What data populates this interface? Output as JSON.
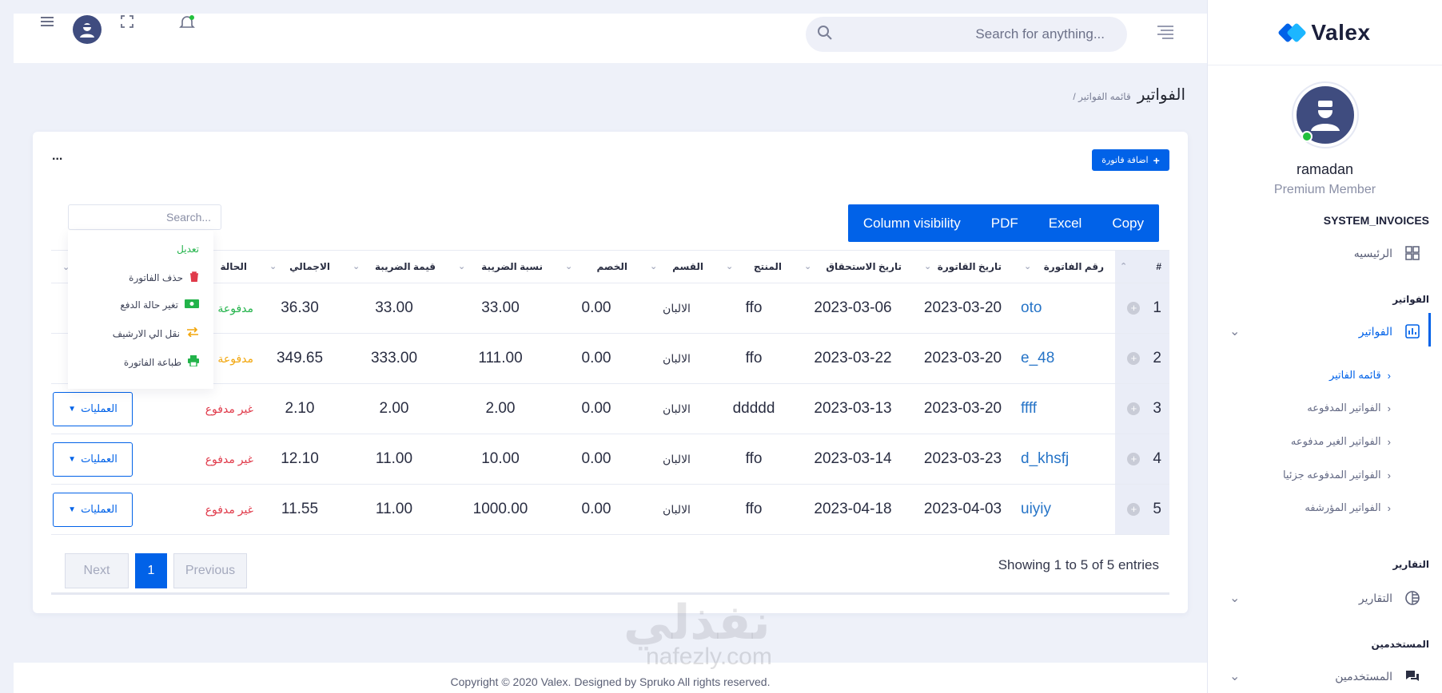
{
  "header": {
    "search_placeholder": "Search for anything..."
  },
  "sidebar": {
    "logo": "Valex",
    "user_name": "ramadan",
    "user_role": "Premium Member",
    "section_main": "SYSTEM_INVOICES",
    "home": "الرئيسيه",
    "section_invoices": "الفواتير",
    "invoices": "الفواتير",
    "sub": [
      "قائمه الفاتير",
      "الفواتير المدفوعه",
      "الفواتير الغير مدفوعه",
      "الفواتير المدفوعه جزئيا",
      "الفواتير المؤرشفه"
    ],
    "section_reports": "التقارير",
    "reports": "التقارير",
    "section_users": "المستخدمين",
    "users": "المستخدمين"
  },
  "breadcrumb": {
    "title": "الفواتير",
    "sub": "/ قائمه الفواتير"
  },
  "card": {
    "add_label": "اضافة فاتورة",
    "menu_dots": "...",
    "export": [
      "Copy",
      "Excel",
      "PDF",
      "Column visibility"
    ],
    "search_placeholder": "Search..."
  },
  "table": {
    "headers": [
      "#",
      "رقم الفاتورة",
      "تاريخ القاتورة",
      "تاريخ الاستحقاق",
      "المنتج",
      "القسم",
      "الخصم",
      "نسبة الضريبة",
      "قيمة الضريبة",
      "الاجمالي",
      "الحالة",
      ""
    ],
    "rows": [
      {
        "num": "1",
        "inv": "oto",
        "date": "2023-03-20",
        "due": "2023-03-06",
        "product": "ffo",
        "dept": "الالبان",
        "discount": "0.00",
        "rate": "33.00",
        "tax": "33.00",
        "total": "36.30",
        "status": "مدفوعة"
      },
      {
        "num": "2",
        "inv": "e_48",
        "date": "2023-03-20",
        "due": "2023-03-22",
        "product": "ffo",
        "dept": "الالبان",
        "discount": "0.00",
        "rate": "111.00",
        "tax": "333.00",
        "total": "349.65",
        "status": "مدفوعة"
      },
      {
        "num": "3",
        "inv": "ffff",
        "date": "2023-03-20",
        "due": "2023-03-13",
        "product": "ddddd",
        "dept": "الالبان",
        "discount": "0.00",
        "rate": "2.00",
        "tax": "2.00",
        "total": "2.10",
        "status": "غير مدفوع"
      },
      {
        "num": "4",
        "inv": "d_khsfj",
        "date": "2023-03-23",
        "due": "2023-03-14",
        "product": "ffo",
        "dept": "الالبان",
        "discount": "0.00",
        "rate": "10.00",
        "tax": "11.00",
        "total": "12.10",
        "status": "غير مدفوع"
      },
      {
        "num": "5",
        "inv": "uiyiy",
        "date": "2023-04-03",
        "due": "2023-04-18",
        "product": "ffo",
        "dept": "الالبان",
        "discount": "0.00",
        "rate": "1000.00",
        "tax": "11.00",
        "total": "11.55",
        "status": "غير مدفوع"
      }
    ],
    "ops_label": "العمليات"
  },
  "context_menu": {
    "edit": "تعديل",
    "delete": "حذف الفاتورة",
    "change_status": "تغير حالة الدفع",
    "archive": "نقل الي الارشيف",
    "print": "طباعة الفاتورة"
  },
  "pagination": {
    "showing": "Showing 1 to 5 of 5 entries",
    "previous": "Previous",
    "current": "1",
    "next": "Next"
  },
  "footer": {
    "copyright": "Copyright © 2020 Valex. Designed by Spruko All rights reserved."
  },
  "watermark": {
    "arabic": "نفذلي",
    "latin": "nafezly.com"
  },
  "colors": {
    "primary": "#0162e8",
    "paid": "#22b34a",
    "unpaid": "#e03a4a"
  }
}
